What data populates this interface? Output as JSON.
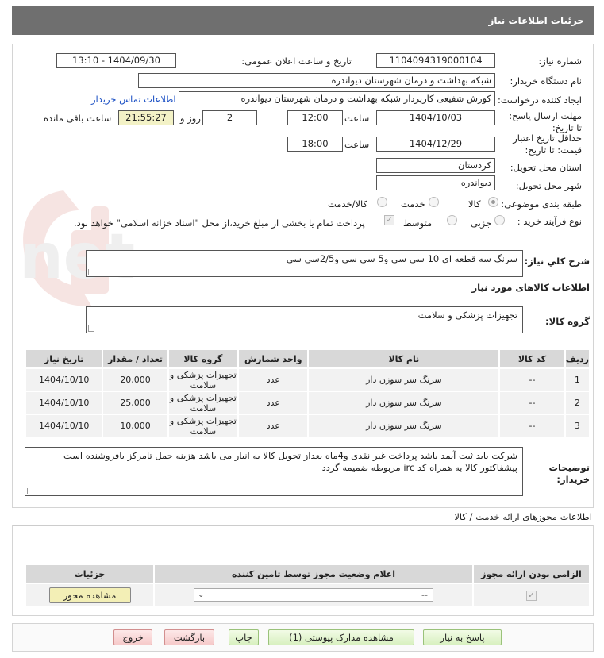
{
  "header": {
    "title": "جزئیات اطلاعات نیاز"
  },
  "fields": {
    "need_number_label": "شماره نیاز:",
    "need_number": "1104094319000104",
    "announce_label": "تاریخ و ساعت اعلان عمومی:",
    "announce_value": "1404/09/30 - 13:10",
    "buyer_org_label": "نام دستگاه خریدار:",
    "buyer_org": "شبکه بهداشت و درمان شهرستان دیواندره",
    "creator_label": "ایجاد کننده درخواست:",
    "creator": "کورش شفیعی کارپرداز شبکه بهداشت و درمان شهرستان دیواندره",
    "contact_link": "اطلاعات تماس خریدار",
    "deadline_label": "مهلت ارسال پاسخ: تا تاریخ:",
    "deadline_date": "1404/10/03",
    "time_label": "ساعت",
    "deadline_time": "12:00",
    "days_value": "2",
    "days_label": "روز و",
    "remaining_time": "21:55:27",
    "remaining_label": "ساعت باقی مانده",
    "validity_label": "حداقل تاریخ اعتبار قیمت: تا تاریخ:",
    "validity_date": "1404/12/29",
    "validity_time": "18:00",
    "province_label": "استان محل تحویل:",
    "province": "کردستان",
    "city_label": "شهر محل تحویل:",
    "city": "دیواندره",
    "category_label": "طبقه بندی موضوعی:",
    "category_options": [
      "کالا",
      "خدمت",
      "کالا/خدمت"
    ],
    "process_label": "نوع فرآیند خرید :",
    "process_options": [
      "جزیی",
      "متوسط"
    ],
    "payment_note": "پرداخت تمام یا بخشی از مبلغ خرید،از محل \"اسناد خزانه اسلامی\" خواهد بود."
  },
  "summary": {
    "label": "شرح کلي نياز:",
    "text": "سرنگ سه قطعه ای 10 سی سی و5 سی سی و2/5سی سی"
  },
  "goods_info": {
    "heading": "اطلاعات کالاهای مورد نیاز",
    "group_label": "گروه کالا:",
    "group_value": "تجهیزات پزشکی و سلامت"
  },
  "items_table": {
    "headers": [
      "ردیف",
      "کد کالا",
      "نام کالا",
      "واحد شمارش",
      "گروه کالا",
      "تعداد / مقدار",
      "تاریخ نیاز"
    ],
    "rows": [
      [
        "1",
        "--",
        "سرنگ سر سوزن دار",
        "عدد",
        "تجهیزات پزشکی و سلامت",
        "20,000",
        "1404/10/10"
      ],
      [
        "2",
        "--",
        "سرنگ سر سوزن دار",
        "عدد",
        "تجهیزات پزشکی و سلامت",
        "25,000",
        "1404/10/10"
      ],
      [
        "3",
        "--",
        "سرنگ سر سوزن دار",
        "عدد",
        "تجهیزات پزشکی و سلامت",
        "10,000",
        "1404/10/10"
      ]
    ]
  },
  "buyer_notes": {
    "label": "توضیحات خریدار:",
    "text": "شرکت باید ثبت آیمد باشد پرداخت غیر نقدی و4ماه بعداز تحویل کالا به انبار می باشد هزینه حمل تامرکز بافروشنده است پیشفاکتور کالا به همراه کد irc مربوطه ضمیمه گردد"
  },
  "license_section": {
    "heading": "اطلاعات مجوزهای ارائه خدمت / کالا",
    "headers": [
      "الزامی بودن ارائه مجوز",
      "اعلام وضعیت مجوز توسط تامین کننده",
      "جزئیات"
    ],
    "select_value": "--",
    "view_button": "مشاهده مجوز"
  },
  "footer_buttons": {
    "reply": "پاسخ به نیاز",
    "attachments": "مشاهده مدارک پیوستی (1)",
    "print": "چاپ",
    "back": "بازگشت",
    "exit": "خروج"
  },
  "watermark_text": "AriaTender.net"
}
